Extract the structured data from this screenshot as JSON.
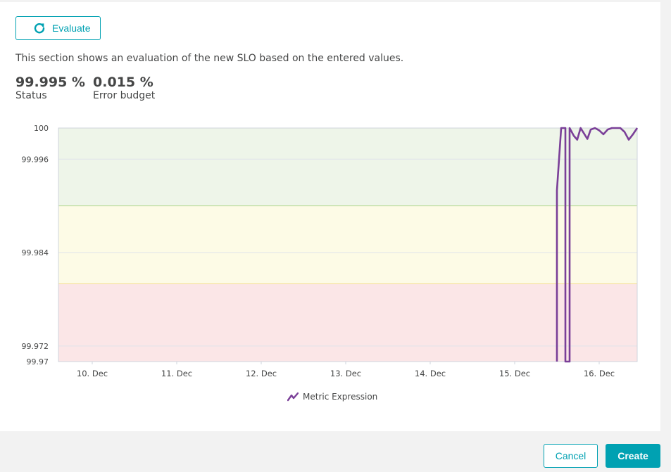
{
  "evaluate": {
    "label": "Evaluate"
  },
  "description": "This section shows an evaluation of the new SLO based on the entered values.",
  "metrics": {
    "status": {
      "value": "99.995 %",
      "label": "Status"
    },
    "error_budget": {
      "value": "0.015 %",
      "label": "Error budget"
    }
  },
  "chart_data": {
    "type": "line",
    "x_tick_labels": [
      "10. Dec",
      "11. Dec",
      "12. Dec",
      "13. Dec",
      "14. Dec",
      "15. Dec",
      "16. Dec"
    ],
    "y_tick_labels": [
      "100",
      "99.996",
      "99.984",
      "99.972",
      "99.97"
    ],
    "y_ticks": [
      100,
      99.996,
      99.984,
      99.972,
      99.97
    ],
    "ylim": [
      99.97,
      100
    ],
    "xlim_days": [
      9.6,
      16.45
    ],
    "bands": [
      {
        "from": 99.99,
        "to": 100,
        "color": "#eef5e9",
        "line": "#b5d991"
      },
      {
        "from": 99.98,
        "to": 99.99,
        "color": "#fdfbe6",
        "line": "#f3dc8e"
      },
      {
        "from": 99.97,
        "to": 99.98,
        "color": "#fbe6e7"
      }
    ],
    "series": [
      {
        "name": "Metric Expression",
        "color": "#7a3f98",
        "points": [
          [
            15.5,
            99.97
          ],
          [
            15.5,
            99.992
          ],
          [
            15.55,
            100
          ],
          [
            15.6,
            100
          ],
          [
            15.6,
            99.97
          ],
          [
            15.65,
            99.97
          ],
          [
            15.65,
            100
          ],
          [
            15.7,
            99.999
          ],
          [
            15.74,
            99.9985
          ],
          [
            15.78,
            100
          ],
          [
            15.82,
            99.9993
          ],
          [
            15.86,
            99.9986
          ],
          [
            15.9,
            99.9998
          ],
          [
            15.95,
            100
          ],
          [
            16.0,
            99.9997
          ],
          [
            16.05,
            99.9992
          ],
          [
            16.1,
            99.9998
          ],
          [
            16.15,
            100
          ],
          [
            16.2,
            100
          ],
          [
            16.25,
            100
          ],
          [
            16.3,
            99.9995
          ],
          [
            16.35,
            99.9985
          ],
          [
            16.4,
            99.9992
          ],
          [
            16.45,
            100
          ]
        ]
      }
    ]
  },
  "legend": {
    "label": "Metric Expression",
    "color": "#7a3f98"
  },
  "footer": {
    "cancel_label": "Cancel",
    "create_label": "Create"
  }
}
